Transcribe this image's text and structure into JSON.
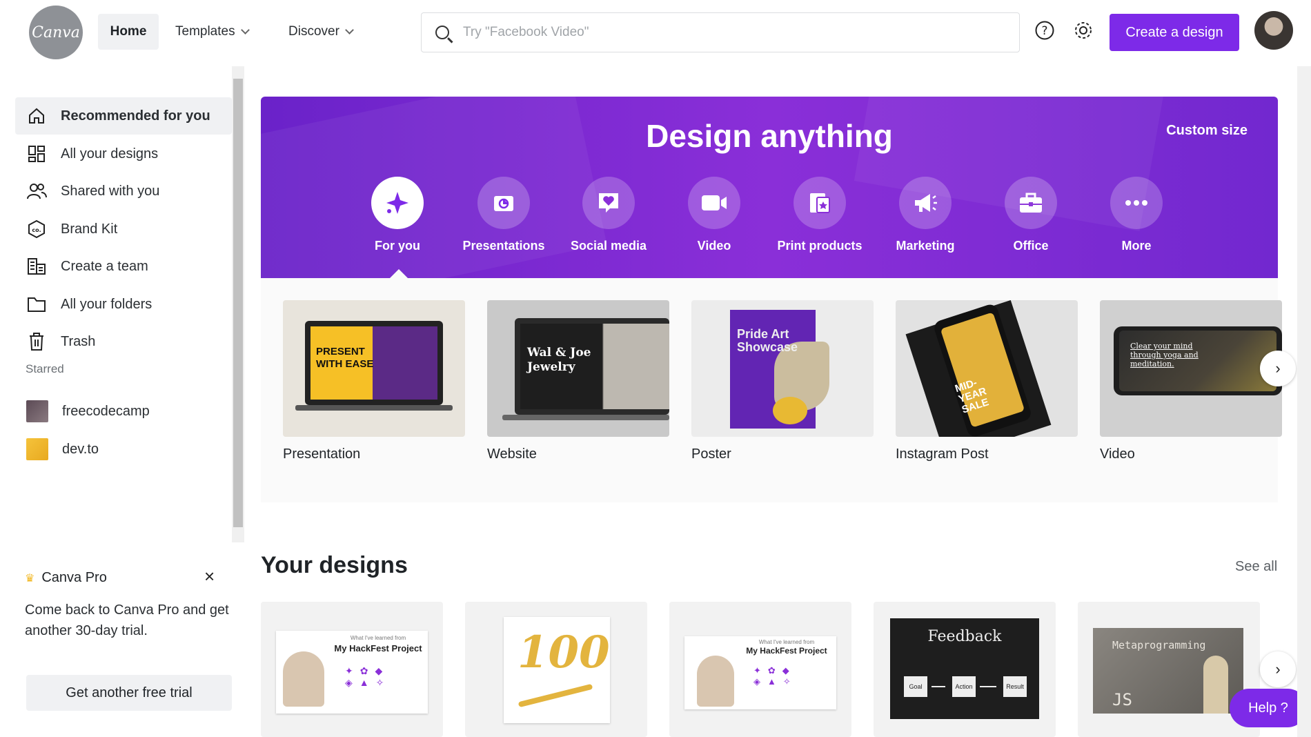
{
  "header": {
    "logo_text": "Canva",
    "nav": {
      "home": "Home",
      "templates": "Templates",
      "discover": "Discover"
    },
    "search": {
      "placeholder": "Try \"Facebook Video\"",
      "icon": "search-icon"
    },
    "help_icon": "question-circle-icon",
    "settings_icon": "gear-icon",
    "create_button": "Create a design"
  },
  "sidebar": {
    "items": [
      {
        "label": "Recommended for you",
        "icon": "home-icon"
      },
      {
        "label": "All your designs",
        "icon": "grid-icon"
      },
      {
        "label": "Shared with you",
        "icon": "people-icon"
      },
      {
        "label": "Brand Kit",
        "icon": "brand-icon"
      },
      {
        "label": "Create a team",
        "icon": "building-icon"
      },
      {
        "label": "All your folders",
        "icon": "folder-icon"
      },
      {
        "label": "Trash",
        "icon": "trash-icon"
      }
    ],
    "starred_label": "Starred",
    "starred": [
      {
        "label": "freecodecamp"
      },
      {
        "label": "dev.to"
      }
    ]
  },
  "promo": {
    "title": "Canva Pro",
    "text": "Come back to Canva Pro and get another 30-day trial.",
    "button": "Get another free trial"
  },
  "hero": {
    "title": "Design anything",
    "custom_size": "Custom size",
    "categories": [
      {
        "label": "For you",
        "icon": "sparkle-icon"
      },
      {
        "label": "Presentations",
        "icon": "presentation-icon"
      },
      {
        "label": "Social media",
        "icon": "heart-chat-icon"
      },
      {
        "label": "Video",
        "icon": "video-camera-icon"
      },
      {
        "label": "Print products",
        "icon": "print-icon"
      },
      {
        "label": "Marketing",
        "icon": "megaphone-icon"
      },
      {
        "label": "Office",
        "icon": "briefcase-icon"
      },
      {
        "label": "More",
        "icon": "more-dots-icon"
      }
    ]
  },
  "templates": [
    {
      "label": "Presentation",
      "thumb_text": "PRESENT WITH EASE"
    },
    {
      "label": "Website",
      "thumb_text": "Wal & Joe Jewelry"
    },
    {
      "label": "Poster",
      "thumb_text": "Pride Art Showcase"
    },
    {
      "label": "Instagram Post",
      "thumb_text": "MID-YEAR SALE"
    },
    {
      "label": "Video",
      "thumb_text": "Clear your mind through yoga and meditation."
    }
  ],
  "designs": {
    "title": "Your designs",
    "see_all": "See all",
    "items": [
      {
        "thumb_title": "My HackFest Project",
        "thumb_sub": "What I've learned from"
      },
      {
        "thumb_title": "100"
      },
      {
        "thumb_title": "My HackFest Project",
        "thumb_sub": "What I've learned from"
      },
      {
        "thumb_title": "Feedback",
        "flow": [
          "Goal",
          "Action",
          "Result"
        ]
      },
      {
        "thumb_title": "Metaprogramming",
        "thumb_sub": "JS"
      }
    ]
  },
  "help_button": "Help  ?",
  "colors": {
    "brand": "#7d2ae8",
    "hero_start": "#6a22c9",
    "hero_end": "#8a2fd8"
  }
}
